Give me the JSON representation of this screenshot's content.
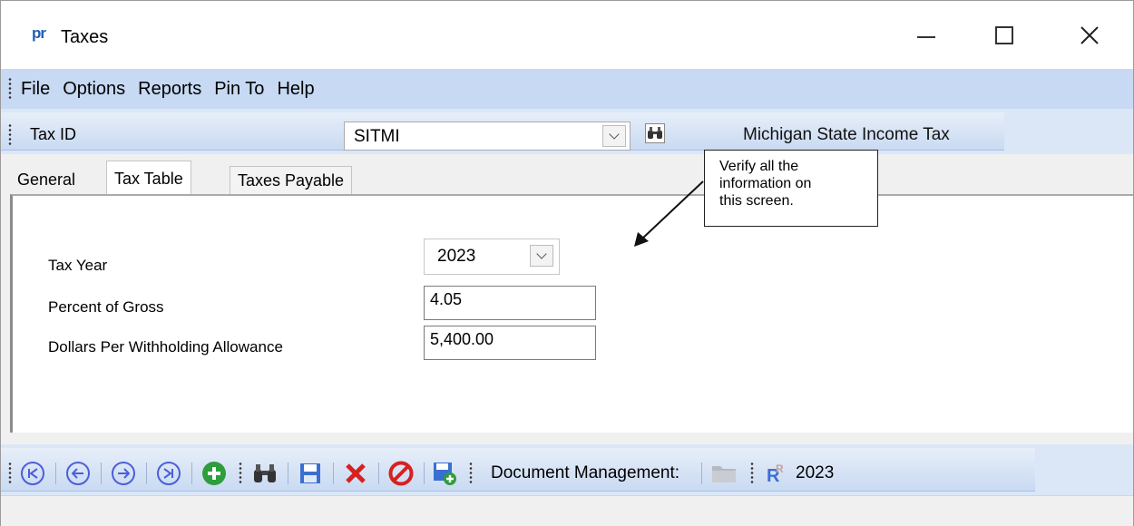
{
  "window": {
    "app_logo": "pr",
    "title": "Taxes"
  },
  "menu": {
    "items": [
      "File",
      "Options",
      "Reports",
      "Pin To",
      "Help"
    ]
  },
  "taxbar": {
    "label": "Tax ID",
    "selected": "SITMI",
    "description": "Michigan State Income Tax"
  },
  "tabs": [
    {
      "label": "General",
      "active": false
    },
    {
      "label": "Tax Table",
      "active": true
    },
    {
      "label": "Taxes Payable",
      "active": false
    }
  ],
  "form": {
    "tax_year_label": "Tax Year",
    "tax_year_value": "2023",
    "percent_label": "Percent of Gross",
    "percent_value": "4.05",
    "dollars_label": "Dollars Per Withholding Allowance",
    "dollars_value": "5,400.00"
  },
  "callout": {
    "text_line1": "Verify all the",
    "text_line2": "information on",
    "text_line3": "this screen."
  },
  "navbar": {
    "document_management_label": "Document Management:",
    "year": "2023",
    "icons": [
      "first-record-icon",
      "previous-record-icon",
      "next-record-icon",
      "last-record-icon",
      "add-icon",
      "find-icon",
      "save-icon",
      "delete-icon",
      "cancel-icon",
      "save-new-icon",
      "folder-icon",
      "report-icon"
    ]
  },
  "colors": {
    "toolbar_blue": "#c7d9f3",
    "nav_icon_blue": "#4c5fd6",
    "add_green": "#2e9d3c",
    "delete_red": "#d72020"
  }
}
